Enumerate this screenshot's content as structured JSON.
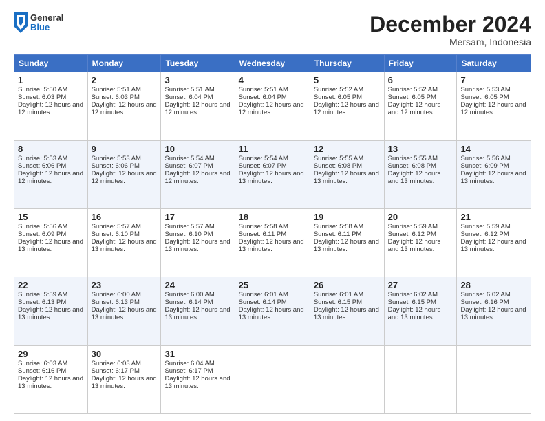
{
  "header": {
    "logo": {
      "general": "General",
      "blue": "Blue"
    },
    "title": "December 2024",
    "location": "Mersam, Indonesia"
  },
  "weekdays": [
    "Sunday",
    "Monday",
    "Tuesday",
    "Wednesday",
    "Thursday",
    "Friday",
    "Saturday"
  ],
  "weeks": [
    [
      {
        "day": 1,
        "sunrise": "5:50 AM",
        "sunset": "6:03 PM",
        "daylight": "12 hours and 12 minutes."
      },
      {
        "day": 2,
        "sunrise": "5:51 AM",
        "sunset": "6:03 PM",
        "daylight": "12 hours and 12 minutes."
      },
      {
        "day": 3,
        "sunrise": "5:51 AM",
        "sunset": "6:04 PM",
        "daylight": "12 hours and 12 minutes."
      },
      {
        "day": 4,
        "sunrise": "5:51 AM",
        "sunset": "6:04 PM",
        "daylight": "12 hours and 12 minutes."
      },
      {
        "day": 5,
        "sunrise": "5:52 AM",
        "sunset": "6:05 PM",
        "daylight": "12 hours and 12 minutes."
      },
      {
        "day": 6,
        "sunrise": "5:52 AM",
        "sunset": "6:05 PM",
        "daylight": "12 hours and 12 minutes."
      },
      {
        "day": 7,
        "sunrise": "5:53 AM",
        "sunset": "6:05 PM",
        "daylight": "12 hours and 12 minutes."
      }
    ],
    [
      {
        "day": 8,
        "sunrise": "5:53 AM",
        "sunset": "6:06 PM",
        "daylight": "12 hours and 12 minutes."
      },
      {
        "day": 9,
        "sunrise": "5:53 AM",
        "sunset": "6:06 PM",
        "daylight": "12 hours and 12 minutes."
      },
      {
        "day": 10,
        "sunrise": "5:54 AM",
        "sunset": "6:07 PM",
        "daylight": "12 hours and 12 minutes."
      },
      {
        "day": 11,
        "sunrise": "5:54 AM",
        "sunset": "6:07 PM",
        "daylight": "12 hours and 13 minutes."
      },
      {
        "day": 12,
        "sunrise": "5:55 AM",
        "sunset": "6:08 PM",
        "daylight": "12 hours and 13 minutes."
      },
      {
        "day": 13,
        "sunrise": "5:55 AM",
        "sunset": "6:08 PM",
        "daylight": "12 hours and 13 minutes."
      },
      {
        "day": 14,
        "sunrise": "5:56 AM",
        "sunset": "6:09 PM",
        "daylight": "12 hours and 13 minutes."
      }
    ],
    [
      {
        "day": 15,
        "sunrise": "5:56 AM",
        "sunset": "6:09 PM",
        "daylight": "12 hours and 13 minutes."
      },
      {
        "day": 16,
        "sunrise": "5:57 AM",
        "sunset": "6:10 PM",
        "daylight": "12 hours and 13 minutes."
      },
      {
        "day": 17,
        "sunrise": "5:57 AM",
        "sunset": "6:10 PM",
        "daylight": "12 hours and 13 minutes."
      },
      {
        "day": 18,
        "sunrise": "5:58 AM",
        "sunset": "6:11 PM",
        "daylight": "12 hours and 13 minutes."
      },
      {
        "day": 19,
        "sunrise": "5:58 AM",
        "sunset": "6:11 PM",
        "daylight": "12 hours and 13 minutes."
      },
      {
        "day": 20,
        "sunrise": "5:59 AM",
        "sunset": "6:12 PM",
        "daylight": "12 hours and 13 minutes."
      },
      {
        "day": 21,
        "sunrise": "5:59 AM",
        "sunset": "6:12 PM",
        "daylight": "12 hours and 13 minutes."
      }
    ],
    [
      {
        "day": 22,
        "sunrise": "5:59 AM",
        "sunset": "6:13 PM",
        "daylight": "12 hours and 13 minutes."
      },
      {
        "day": 23,
        "sunrise": "6:00 AM",
        "sunset": "6:13 PM",
        "daylight": "12 hours and 13 minutes."
      },
      {
        "day": 24,
        "sunrise": "6:00 AM",
        "sunset": "6:14 PM",
        "daylight": "12 hours and 13 minutes."
      },
      {
        "day": 25,
        "sunrise": "6:01 AM",
        "sunset": "6:14 PM",
        "daylight": "12 hours and 13 minutes."
      },
      {
        "day": 26,
        "sunrise": "6:01 AM",
        "sunset": "6:15 PM",
        "daylight": "12 hours and 13 minutes."
      },
      {
        "day": 27,
        "sunrise": "6:02 AM",
        "sunset": "6:15 PM",
        "daylight": "12 hours and 13 minutes."
      },
      {
        "day": 28,
        "sunrise": "6:02 AM",
        "sunset": "6:16 PM",
        "daylight": "12 hours and 13 minutes."
      }
    ],
    [
      {
        "day": 29,
        "sunrise": "6:03 AM",
        "sunset": "6:16 PM",
        "daylight": "12 hours and 13 minutes."
      },
      {
        "day": 30,
        "sunrise": "6:03 AM",
        "sunset": "6:17 PM",
        "daylight": "12 hours and 13 minutes."
      },
      {
        "day": 31,
        "sunrise": "6:04 AM",
        "sunset": "6:17 PM",
        "daylight": "12 hours and 13 minutes."
      },
      null,
      null,
      null,
      null
    ]
  ]
}
